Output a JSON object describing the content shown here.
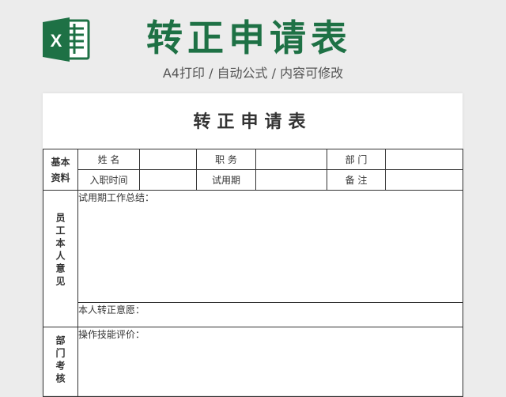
{
  "banner": {
    "title": "转正申请表",
    "subtitle": "A4打印 / 自动公式 / 内容可修改",
    "logo_letter": "X",
    "colors": {
      "brand": "#1e7145"
    }
  },
  "form": {
    "title": "转正申请表",
    "basic": {
      "section_label_1": "基本",
      "section_label_2": "资料",
      "name_label": "姓 名",
      "position_label": "职 务",
      "dept_label": "部 门",
      "entry_label": "入职时间",
      "probation_label": "试用期",
      "note_label": "备 注"
    },
    "employee": {
      "section_label": "员工本人意见",
      "summary_label": "试用期工作总结：",
      "wish_label": "本人转正意愿："
    },
    "department": {
      "section_label": "部门考核",
      "skill_label": "操作技能评价："
    }
  }
}
